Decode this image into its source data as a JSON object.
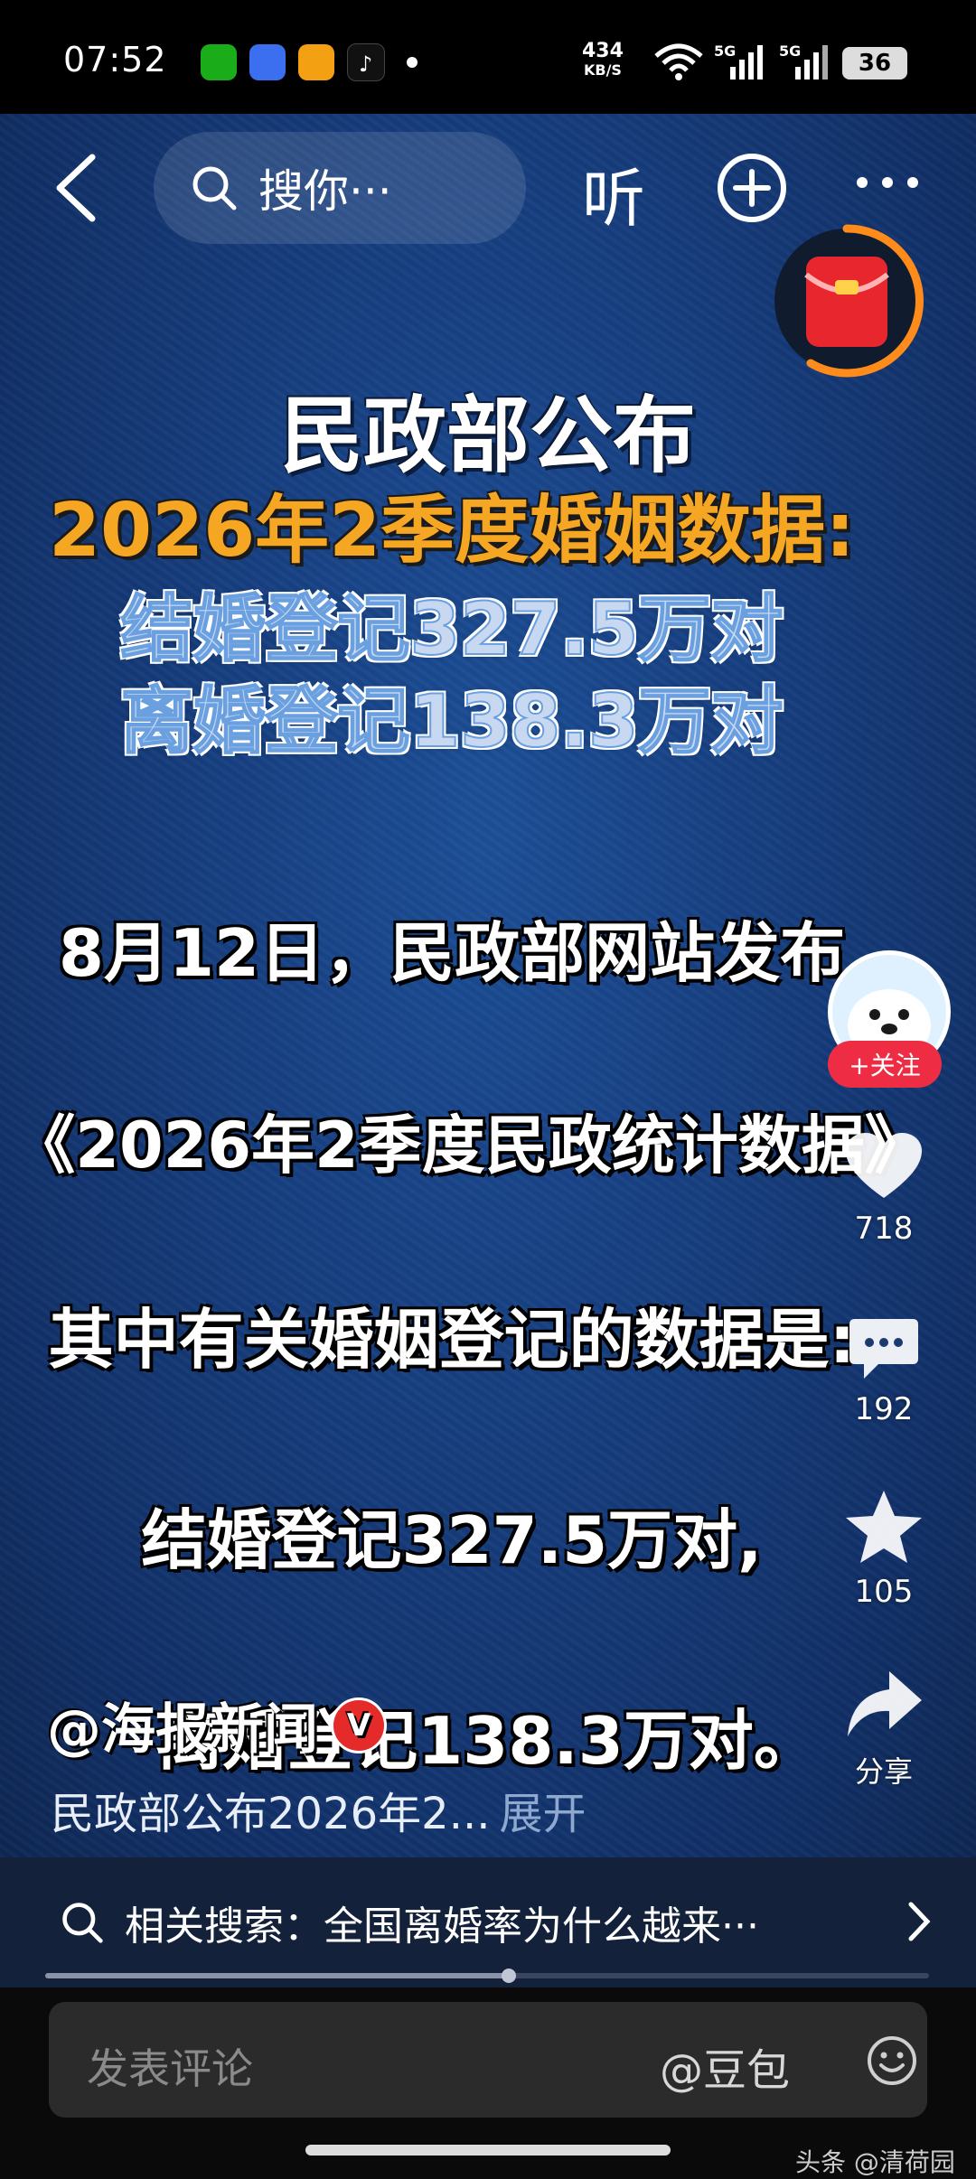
{
  "status_bar": {
    "time": "07:52",
    "net_speed_value": "434",
    "net_speed_unit": "KB/S",
    "sim1": "5G",
    "sim2": "5G",
    "battery": "36"
  },
  "top_bar": {
    "search_text": "搜你···",
    "listen_label": "听"
  },
  "video_overlay": {
    "line1": "民政部公布",
    "line2": "2026年2季度婚姻数据:",
    "line3": "结婚登记327.5万对",
    "line4": "离婚登记138.3万对",
    "sub1": "8月12日，民政部网站发布",
    "sub2": "《2026年2季度民政统计数据》",
    "sub3": "其中有关婚姻登记的数据是:",
    "sub4": "结婚登记327.5万对,",
    "sub5": "离婚登记138.3万对。"
  },
  "side_rail": {
    "follow_label": "+关注",
    "likes": "718",
    "comments": "192",
    "favorites": "105",
    "share_label": "分享"
  },
  "author": {
    "name": "@海报新闻",
    "verified_label": "V"
  },
  "caption": {
    "text": "民政部公布2026年2...",
    "expand_label": "展开"
  },
  "related_search": {
    "text": "相关搜索：全国离婚率为什么越来···"
  },
  "progress": {
    "fraction": 0.525
  },
  "comment_bar": {
    "placeholder": "发表评论",
    "mention": "@豆包"
  },
  "watermark": "头条 @清荷园",
  "colors": {
    "accent_red": "#ee2c44",
    "orange_title": "#f5a623",
    "video_blue": "#173f80"
  }
}
